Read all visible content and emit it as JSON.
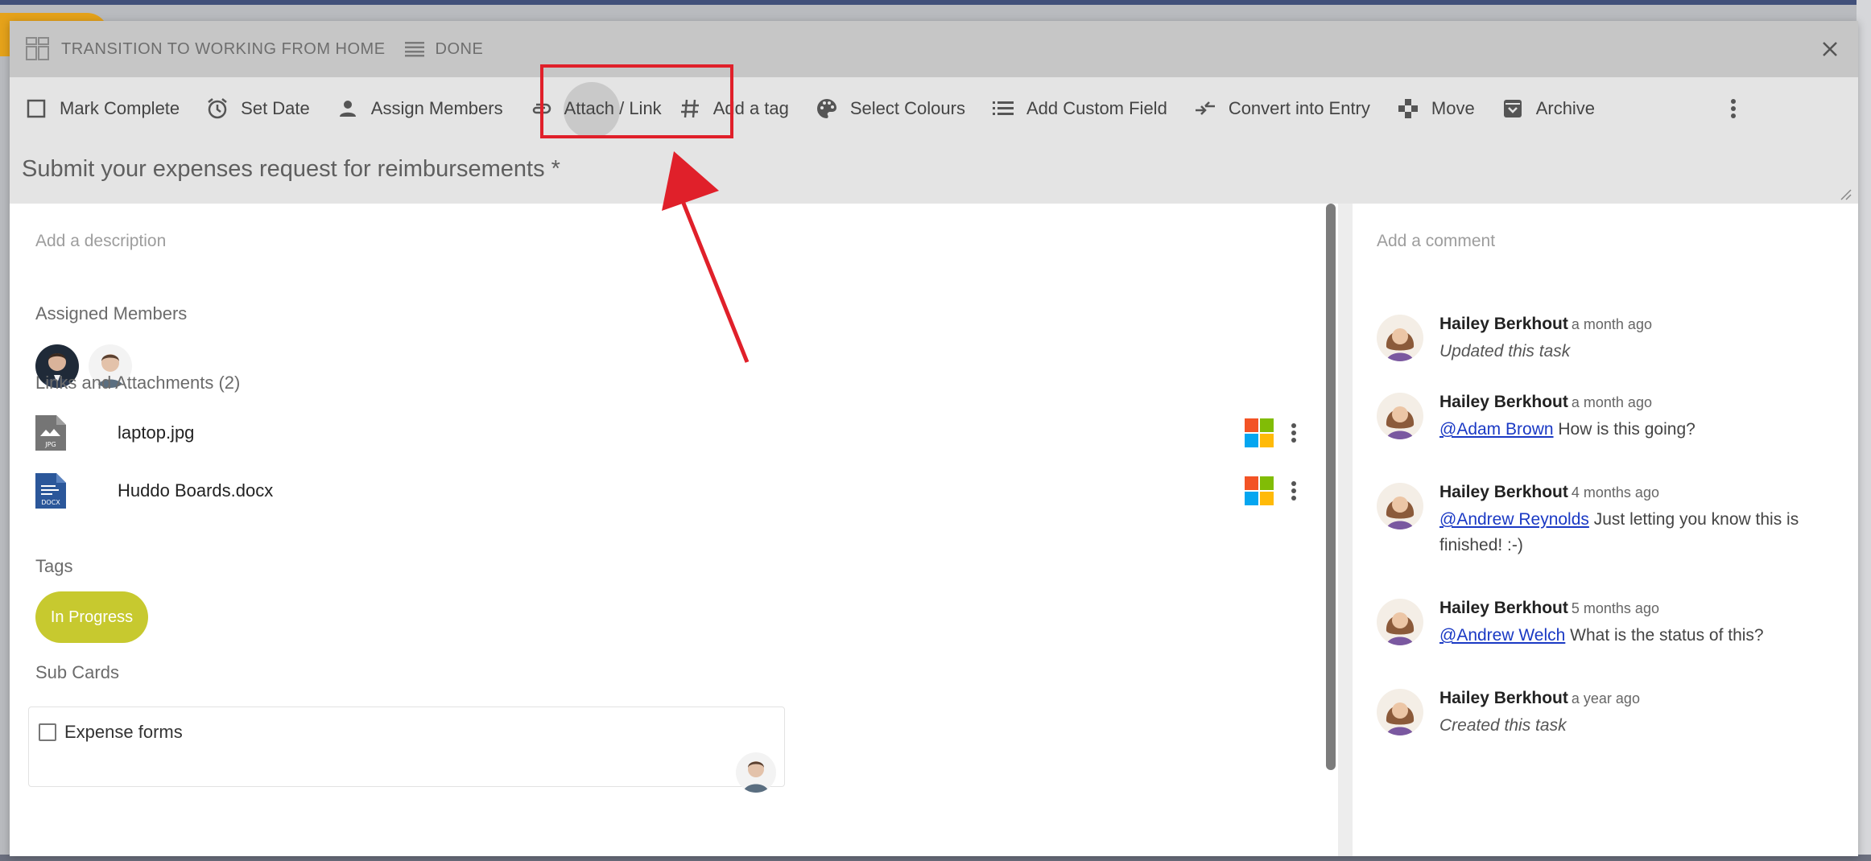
{
  "header": {
    "board_name": "TRANSITION TO WORKING FROM HOME",
    "list_name": "DONE"
  },
  "toolbar": {
    "items": [
      {
        "label": "Mark Complete",
        "icon": "checkbox-outline-icon"
      },
      {
        "label": "Set Date",
        "icon": "alarm-clock-icon"
      },
      {
        "label": "Assign Members",
        "icon": "person-icon"
      },
      {
        "label": "Attach / Link",
        "icon": "paperclip-icon"
      },
      {
        "label": "Add a tag",
        "icon": "hash-icon"
      },
      {
        "label": "Select Colours",
        "icon": "palette-icon"
      },
      {
        "label": "Add Custom Field",
        "icon": "list-icon"
      },
      {
        "label": "Convert into Entry",
        "icon": "convert-arrows-icon"
      },
      {
        "label": "Move",
        "icon": "move-arrows-icon"
      },
      {
        "label": "Archive",
        "icon": "archive-box-icon"
      }
    ]
  },
  "card": {
    "title": "Submit your expenses request for reimbursements *",
    "description_placeholder": "Add a description",
    "assigned_members_label": "Assigned Members",
    "attachments_label": "Links and Attachments (2)",
    "attachments": [
      {
        "name": "laptop.jpg",
        "type": "JPG",
        "color": "#757575"
      },
      {
        "name": "Huddo Boards.docx",
        "type": "DOCX",
        "color": "#2b579a"
      }
    ],
    "tags_label": "Tags",
    "tags": [
      {
        "label": "In Progress",
        "color": "#c7c92f"
      }
    ],
    "subcards_label": "Sub Cards",
    "subcards": [
      {
        "label": "Expense forms"
      }
    ]
  },
  "comments": {
    "placeholder": "Add a comment",
    "items": [
      {
        "author": "Hailey Berkhout",
        "time": "a month ago",
        "text": "Updated this task",
        "mention": ""
      },
      {
        "author": "Hailey Berkhout",
        "time": "a month ago",
        "mention": "@Adam Brown",
        "text": " How is this going?"
      },
      {
        "author": "Hailey Berkhout",
        "time": "4 months ago",
        "mention": "@Andrew Reynolds",
        "text": " Just letting you know this is finished! :-)"
      },
      {
        "author": "Hailey Berkhout",
        "time": "5 months ago",
        "mention": "@Andrew Welch",
        "text": " What is the status of this?"
      },
      {
        "author": "Hailey Berkhout",
        "time": "a year ago",
        "text": "Created this task",
        "mention": ""
      }
    ]
  },
  "colors": {
    "accent_tag": "#c7c92f",
    "annotation_red": "#e0202a",
    "mention_link": "#1a39c4"
  }
}
